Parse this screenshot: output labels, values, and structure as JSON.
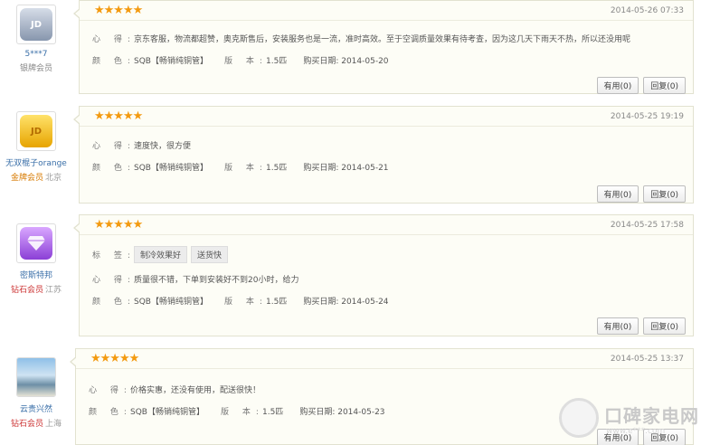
{
  "reviews": [
    {
      "user": {
        "name": "5***7",
        "level": "银牌会员",
        "location": "",
        "avatar_icon": "jd-silver-badge-icon",
        "avatar_text": "JD"
      },
      "stars": "★★★★★",
      "date": "2014-05-26 07:33",
      "heart_label": "心 得:",
      "heart_text": "京东客服，物流都超赞，奥克斯售后，安装服务也是一流，准时高效。至于空调质量效果有待考查，因为这几天下雨天不热，所以还没用呢",
      "color_label": "颜 色:",
      "color_value": "SQB【畅销纯铜管】",
      "version_label": "版 本:",
      "version_value": "1.5匹",
      "buy_label": "购买日期:",
      "buy_date": "2014-05-20",
      "useful": "有用(0)",
      "reply": "回复(0)"
    },
    {
      "user": {
        "name": "无双棍子orange",
        "level": "金牌会员",
        "location": "北京",
        "avatar_icon": "jd-gold-badge-icon",
        "avatar_text": "JD"
      },
      "stars": "★★★★★",
      "date": "2014-05-25 19:19",
      "heart_label": "心 得:",
      "heart_text": "速度快，很方便",
      "color_label": "颜 色:",
      "color_value": "SQB【畅销纯铜管】",
      "version_label": "版 本:",
      "version_value": "1.5匹",
      "buy_label": "购买日期:",
      "buy_date": "2014-05-21",
      "useful": "有用(0)",
      "reply": "回复(0)"
    },
    {
      "user": {
        "name": "密斯特邦",
        "level": "钻石会员",
        "location": "江苏",
        "avatar_icon": "diamond-badge-icon",
        "avatar_text": ""
      },
      "stars": "★★★★★",
      "date": "2014-05-25 17:58",
      "tag_label": "标 签:",
      "tags": [
        "制冷效果好",
        "送货快"
      ],
      "heart_label": "心 得:",
      "heart_text": "质量很不错，下单到安装好不到20小时，给力",
      "color_label": "颜 色:",
      "color_value": "SQB【畅销纯铜管】",
      "version_label": "版 本:",
      "version_value": "1.5匹",
      "buy_label": "购买日期:",
      "buy_date": "2014-05-24",
      "useful": "有用(0)",
      "reply": "回复(0)"
    },
    {
      "user": {
        "name": "云贵兴然",
        "level": "钻石会员",
        "location": "上海",
        "avatar_icon": "user-photo-icon",
        "avatar_text": ""
      },
      "stars": "★★★★★",
      "date": "2014-05-25 13:37",
      "heart_label": "心 得:",
      "heart_text": "价格实惠，还没有使用，配送很快！",
      "color_label": "颜 色:",
      "color_value": "SQB【畅销纯铜管】",
      "version_label": "版 本:",
      "version_value": "1.5匹",
      "buy_label": "购买日期:",
      "buy_date": "2014-05-23",
      "useful": "有用(0)",
      "reply": "回复(0)"
    }
  ],
  "watermark": {
    "text": "口碑家电网",
    "url": "www.e***.com",
    "icon": "site-logo-icon"
  },
  "colors": {
    "star": "#f39a10",
    "gold_level": "#d77a00",
    "diamond_level": "#cc3333",
    "username": "#3a6fa8"
  }
}
